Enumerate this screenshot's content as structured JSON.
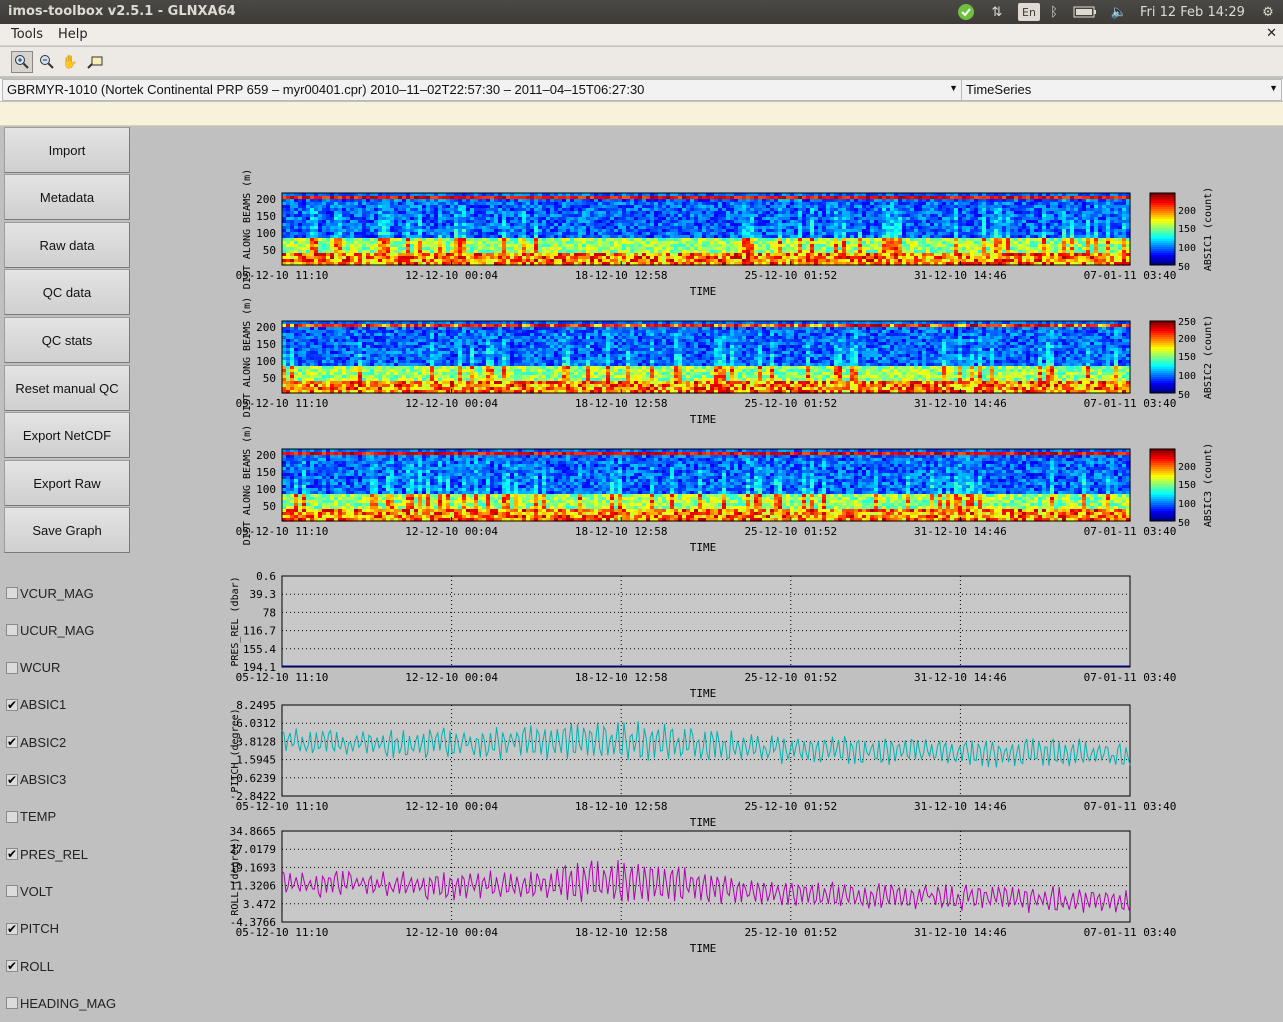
{
  "window": {
    "title": "imos-toolbox v2.5.1 - GLNXA64"
  },
  "tray": {
    "lang": "En",
    "clock": "Fri 12 Feb 14:29"
  },
  "menu": {
    "items": [
      "Tools",
      "Help"
    ]
  },
  "selectors": {
    "dataset": "GBRMYR-1010 (Nortek Continental PRP 659     – myr00401.cpr) 2010–11–02T22:57:30 – 2011–04–15T06:27:30",
    "mode": "TimeSeries"
  },
  "buttons": [
    "Import",
    "Metadata",
    "Raw data",
    "QC data",
    "QC stats",
    "Reset manual QC",
    "Export NetCDF",
    "Export Raw",
    "Save Graph"
  ],
  "variables": [
    {
      "name": "VCUR_MAG",
      "checked": false
    },
    {
      "name": "UCUR_MAG",
      "checked": false
    },
    {
      "name": "WCUR",
      "checked": false
    },
    {
      "name": "ABSIC1",
      "checked": true
    },
    {
      "name": "ABSIC2",
      "checked": true
    },
    {
      "name": "ABSIC3",
      "checked": true
    },
    {
      "name": "TEMP",
      "checked": false
    },
    {
      "name": "PRES_REL",
      "checked": true
    },
    {
      "name": "VOLT",
      "checked": false
    },
    {
      "name": "PITCH",
      "checked": true
    },
    {
      "name": "ROLL",
      "checked": true
    },
    {
      "name": "HEADING_MAG",
      "checked": false
    }
  ],
  "time_ticks": [
    "05-12-10 11:10",
    "12-12-10 00:04",
    "18-12-10 12:58",
    "25-12-10 01:52",
    "31-12-10 14:46",
    "07-01-11 03:40"
  ],
  "colors": {
    "pitch": "#00b2b2",
    "roll": "#b200b2",
    "pres": "#0000cc"
  },
  "chart_data": [
    {
      "type": "heatmap",
      "ylabel": "DIST ALONG BEAMS (m)",
      "xlabel": "TIME",
      "colorbar_label": "ABSIC1 (count)",
      "yticks": [
        "200",
        "150",
        "100",
        "50"
      ],
      "colorbar_ticks": [
        "200",
        "150",
        "100",
        "50"
      ]
    },
    {
      "type": "heatmap",
      "ylabel": "DIST ALONG BEAMS (m)",
      "xlabel": "TIME",
      "colorbar_label": "ABSIC2 (count)",
      "yticks": [
        "200",
        "150",
        "100",
        "50"
      ],
      "colorbar_ticks": [
        "250",
        "200",
        "150",
        "100",
        "50"
      ]
    },
    {
      "type": "heatmap",
      "ylabel": "DIST ALONG BEAMS (m)",
      "xlabel": "TIME",
      "colorbar_label": "ABSIC3 (count)",
      "yticks": [
        "200",
        "150",
        "100",
        "50"
      ],
      "colorbar_ticks": [
        "200",
        "150",
        "100",
        "50"
      ]
    },
    {
      "type": "line",
      "ylabel": "PRES_REL (dbar)",
      "xlabel": "TIME",
      "yticks": [
        "0.6",
        "39.3",
        "78",
        "116.7",
        "155.4",
        "194.1"
      ],
      "ylim": [
        0.6,
        194.1
      ],
      "inverted": true,
      "value": 192
    },
    {
      "type": "line",
      "ylabel": "PITCH (degree)",
      "xlabel": "TIME",
      "yticks": [
        "8.2495",
        "6.0312",
        "3.8128",
        "1.5945",
        "-0.6239",
        "-2.8422"
      ],
      "ylim": [
        -2.8422,
        8.2495
      ],
      "mean_start": 3.8,
      "mean_end": 2.2,
      "amp": 1.6,
      "peak_day": 13,
      "peak_gain": 1.5
    },
    {
      "type": "line",
      "ylabel": "ROLL (degree)",
      "xlabel": "TIME",
      "yticks": [
        "34.8665",
        "27.0179",
        "19.1693",
        "11.3206",
        "3.472",
        "-4.3766"
      ],
      "ylim": [
        -4.3766,
        34.8665
      ],
      "mean_start": 12.5,
      "mean_end": 4.5,
      "amp": 5.0,
      "peak_day": 13,
      "peak_gain": 8.0
    }
  ]
}
